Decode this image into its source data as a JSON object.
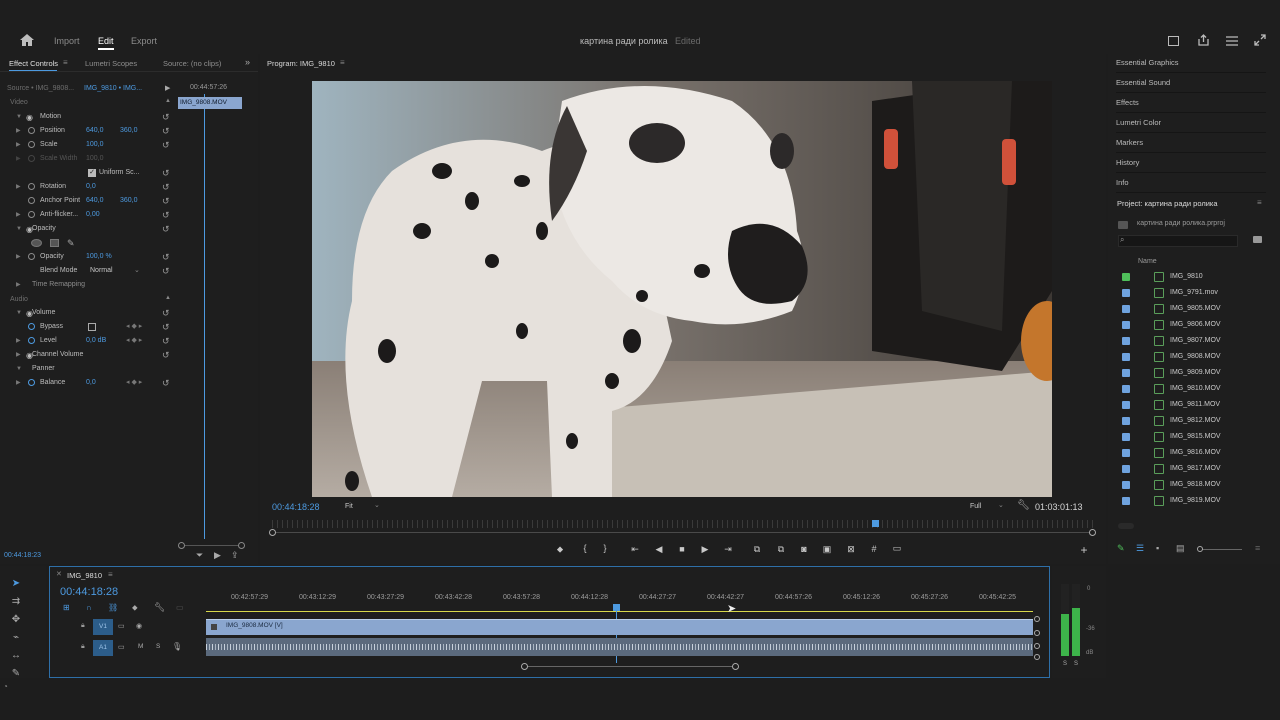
{
  "top_nav": {
    "import": "Import",
    "edit": "Edit",
    "export": "Export"
  },
  "app_title": {
    "project": "картина ради ролика",
    "status": "Edited"
  },
  "effect_controls": {
    "tabs": [
      "Effect Controls",
      "Lumetri Scopes",
      "Source: (no clips)"
    ],
    "source_label": "Source • IMG_9808...",
    "sequence_label": "IMG_9810 • IMG...",
    "timecode_top": "00:44:57:26",
    "clip_label": "IMG_9808.MOV",
    "sections": {
      "video": "Video",
      "audio": "Audio"
    },
    "rows": [
      {
        "label": "Motion"
      },
      {
        "label": "Position",
        "v1": "640,0",
        "v2": "360,0"
      },
      {
        "label": "Scale",
        "v1": "100,0"
      },
      {
        "label": "Scale Width",
        "v1": "100,0"
      },
      {
        "label": "Uniform Sc..."
      },
      {
        "label": "Rotation",
        "v1": "0,0"
      },
      {
        "label": "Anchor Point",
        "v1": "640,0",
        "v2": "360,0"
      },
      {
        "label": "Anti-flicker...",
        "v1": "0,00"
      },
      {
        "label": "Opacity"
      },
      {
        "label": "Opacity",
        "v1": "100,0 %"
      },
      {
        "label": "Blend Mode",
        "v1": "Normal"
      },
      {
        "label": "Time Remapping"
      },
      {
        "label": "Volume"
      },
      {
        "label": "Bypass"
      },
      {
        "label": "Level",
        "v1": "0,0 dB"
      },
      {
        "label": "Channel Volume"
      },
      {
        "label": "Panner"
      },
      {
        "label": "Balance",
        "v1": "0,0"
      }
    ],
    "bottom_timecode": "00:44:18:23"
  },
  "program_monitor": {
    "title": "Program: IMG_9810",
    "timecode": "00:44:18:28",
    "fit": "Fit",
    "quality": "Full",
    "duration": "01:03:01:13",
    "playhead_fraction": 0.73
  },
  "right_panels": {
    "items": [
      "Essential Graphics",
      "Essential Sound",
      "Effects",
      "Lumetri Color",
      "Markers",
      "History",
      "Info"
    ],
    "project_title": "Project: картина ради ролика",
    "project_file": "картина ради ролика.prproj",
    "column_name": "Name",
    "clips": [
      "IMG_9810",
      "IMG_9791.mov",
      "IMG_9805.MOV",
      "IMG_9806.MOV",
      "IMG_9807.MOV",
      "IMG_9808.MOV",
      "IMG_9809.MOV",
      "IMG_9810.MOV",
      "IMG_9811.MOV",
      "IMG_9812.MOV",
      "IMG_9815.MOV",
      "IMG_9816.MOV",
      "IMG_9817.MOV",
      "IMG_9818.MOV",
      "IMG_9819.MOV"
    ]
  },
  "timeline": {
    "sequence_tab": "IMG_9810",
    "timecode": "00:44:18:28",
    "ruler": [
      "00:42:57:29",
      "00:43:12:29",
      "00:43:27:29",
      "00:43:42:28",
      "00:43:57:28",
      "00:44:12:28",
      "00:44:27:27",
      "00:44:42:27",
      "00:44:57:26",
      "00:45:12:26",
      "00:45:27:26",
      "00:45:42:25"
    ],
    "v1": "V1",
    "a1": "A1",
    "clip_name": "IMG_9808.MOV [V]",
    "track_m": "M",
    "track_s": "S"
  },
  "meter": {
    "labels": [
      "0",
      "-36",
      "dB"
    ],
    "s1": "S",
    "s2": "S"
  },
  "colors": {
    "accent": "#4d9ae0",
    "clip": "#8aa6cf",
    "label_green": "#4fbf5a"
  }
}
